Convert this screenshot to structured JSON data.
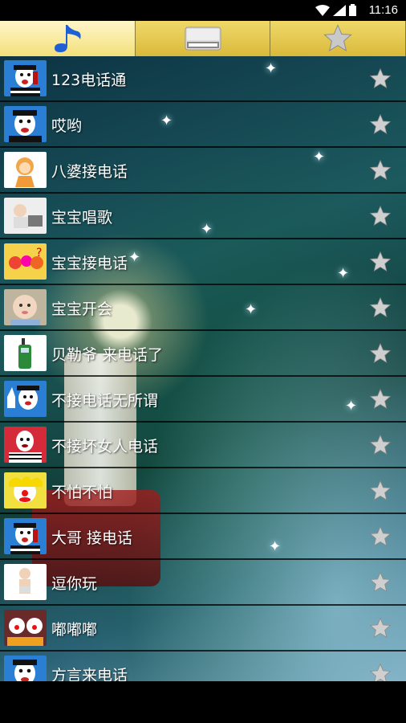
{
  "status": {
    "time": "11:16"
  },
  "tabs": [
    {
      "name": "ringtones",
      "icon": "music-note-icon",
      "active": true
    },
    {
      "name": "storage",
      "icon": "sd-card-icon",
      "active": false
    },
    {
      "name": "favorites",
      "icon": "star-icon",
      "active": false
    }
  ],
  "colors": {
    "tab_gold": "#e3c448",
    "tab_active": "#fbefb5",
    "text": "#ffffff"
  },
  "list": [
    {
      "title": "123电话通",
      "thumb": "mime-phone"
    },
    {
      "title": "哎哟",
      "thumb": "mime-face"
    },
    {
      "title": "八婆接电话",
      "thumb": "cartoon-girl"
    },
    {
      "title": "宝宝唱歌",
      "thumb": "baby-laptop"
    },
    {
      "title": "宝宝接电话",
      "thumb": "balls"
    },
    {
      "title": "宝宝开会",
      "thumb": "baby-face"
    },
    {
      "title": "贝勒爷 来电话了",
      "thumb": "walkie-talkie"
    },
    {
      "title": "不接电话无所谓",
      "thumb": "mime-hand"
    },
    {
      "title": "不接坏女人电话",
      "thumb": "mime-stripe"
    },
    {
      "title": "不怕不怕",
      "thumb": "clown"
    },
    {
      "title": "大哥 接电话",
      "thumb": "mime-phone"
    },
    {
      "title": "逗你玩",
      "thumb": "baby-stand"
    },
    {
      "title": "嘟嘟嘟",
      "thumb": "clowns"
    },
    {
      "title": "方言来电话",
      "thumb": "mime-face"
    }
  ]
}
